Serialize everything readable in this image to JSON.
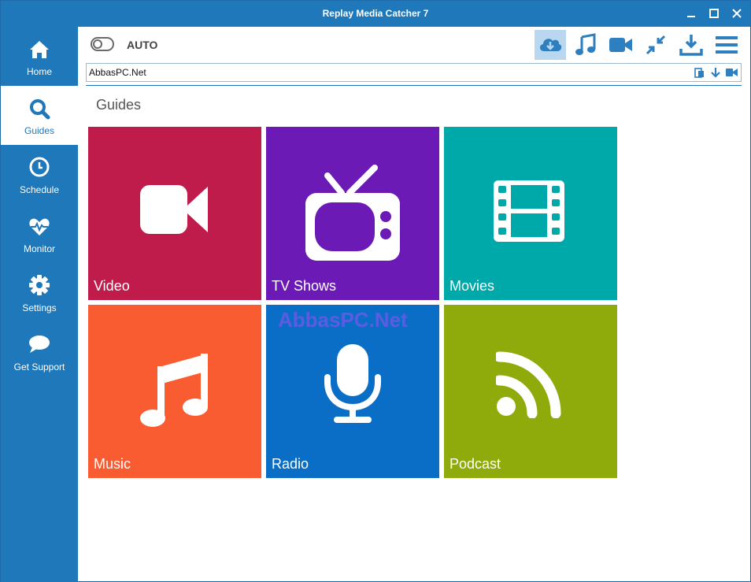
{
  "window": {
    "title": "Replay Media Catcher 7"
  },
  "sidebar": {
    "items": [
      {
        "label": "Home",
        "icon": "home-icon"
      },
      {
        "label": "Guides",
        "icon": "search-icon"
      },
      {
        "label": "Schedule",
        "icon": "clock-icon"
      },
      {
        "label": "Monitor",
        "icon": "heartbeat-icon"
      },
      {
        "label": "Settings",
        "icon": "gear-icon"
      },
      {
        "label": "Get Support",
        "icon": "chat-icon"
      }
    ],
    "active": "Guides"
  },
  "toolbar": {
    "auto_label": "AUTO",
    "buttons": [
      "cloud-download-icon",
      "music-note-icon",
      "video-camera-icon",
      "compress-icon",
      "download-tray-icon",
      "menu-icon"
    ]
  },
  "urlbar": {
    "value": "AbbasPC.Net",
    "icons": [
      "paste-icon",
      "arrow-down-icon",
      "video-camera-icon"
    ]
  },
  "guides": {
    "title": "Guides",
    "tiles": [
      {
        "label": "Video",
        "color": "#c01c4b",
        "icon": "video-camera-icon"
      },
      {
        "label": "TV Shows",
        "color": "#6c1ab5",
        "icon": "tv-icon"
      },
      {
        "label": "Movies",
        "color": "#00a9a9",
        "icon": "film-icon"
      },
      {
        "label": "Music",
        "color": "#f95c31",
        "icon": "music-note-icon"
      },
      {
        "label": "Radio",
        "color": "#0b6ec6",
        "icon": "microphone-icon"
      },
      {
        "label": "Podcast",
        "color": "#8faa0b",
        "icon": "rss-icon"
      }
    ]
  },
  "watermark": "AbbasPC.Net",
  "colors": {
    "accent": "#1f78b9",
    "active_button_bg": "#b9d8f0"
  }
}
